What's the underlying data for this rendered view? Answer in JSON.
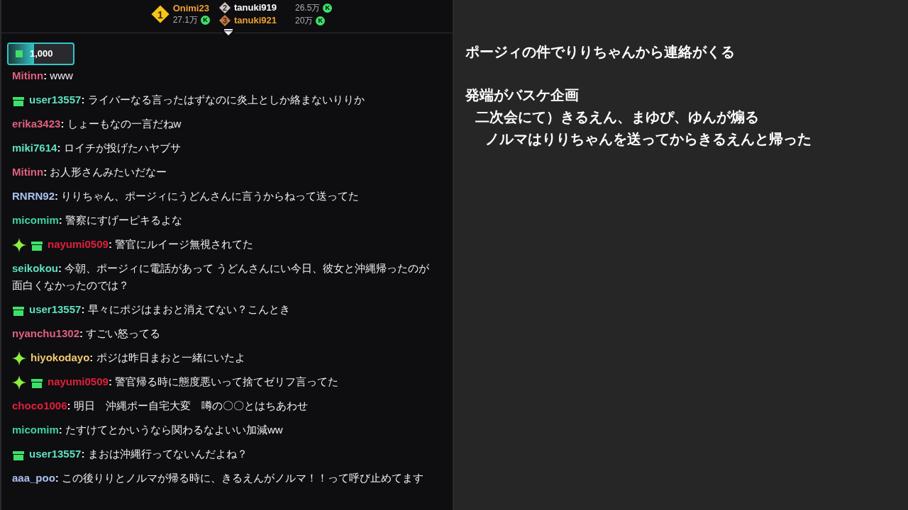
{
  "leaderboard": [
    {
      "rank": "1",
      "name": "Onimi23",
      "points": "27.1万",
      "coin": "K"
    },
    {
      "rank": "2",
      "name": "tanuki919",
      "points": "26.5万",
      "coin": "K"
    },
    {
      "rank": "3",
      "name": "tanuki921",
      "points": "20万",
      "coin": "K"
    }
  ],
  "hype": {
    "amount": "1,000",
    "level": 0.4
  },
  "messages": [
    {
      "user": "Mitinn",
      "color": "#e0607e",
      "separator": ":",
      "text": "www"
    },
    {
      "badges": [
        {
          "kind": "gift"
        }
      ],
      "user": "user13557",
      "color": "#5fe0c0",
      "separator": ":",
      "text": "ライバーなる言ったはずなのに炎上としか絡まないりりか"
    },
    {
      "user": "erika3423",
      "color": "#e0607e",
      "separator": ":",
      "text": "しょーもなの一言だねw"
    },
    {
      "user": "miki7614",
      "color": "#5fe0c0",
      "separator": ":",
      "text": "ロイチが投げたハヤブサ"
    },
    {
      "user": "Mitinn",
      "color": "#e0607e",
      "separator": ":",
      "text": "お人形さんみたいだなー"
    },
    {
      "user": "RNRN92",
      "color": "#a8c0f0",
      "separator": ":",
      "text": "りりちゃん、ポージィにうどんさんに言うからねって送ってた"
    },
    {
      "user": "micomim",
      "color": "#3fd0a0",
      "separator": ":",
      "text": "警察にすげーピキるよな"
    },
    {
      "badges": [
        {
          "kind": "sparkle"
        },
        {
          "kind": "gift"
        }
      ],
      "user": "nayumi0509",
      "color": "#e0203c",
      "separator": ":",
      "text": "警官にルイージ無視されてた"
    },
    {
      "user": "seikokou",
      "color": "#5fe0c0",
      "separator": ":",
      "text": "今朝、ポージィに電話があって うどんさんにい今日、彼女と沖縄帰ったのが面白くなかったのでは？"
    },
    {
      "badges": [
        {
          "kind": "gift"
        }
      ],
      "user": "user13557",
      "color": "#5fe0c0",
      "separator": ":",
      "text": "早々にポジはまおと消えてない？こんとき"
    },
    {
      "user": "nyanchu1302",
      "color": "#e0607e",
      "separator": ":",
      "text": "すごい怒ってる"
    },
    {
      "badges": [
        {
          "kind": "sparkle"
        }
      ],
      "user": "hiyokodayo",
      "color": "#f0c870",
      "separator": ":",
      "text": "ポジは昨日まおと一緒にいたよ"
    },
    {
      "badges": [
        {
          "kind": "sparkle"
        },
        {
          "kind": "gift"
        }
      ],
      "user": "nayumi0509",
      "color": "#e0203c",
      "separator": ":",
      "text": "警官帰る時に態度悪いって捨てゼリフ言ってた"
    },
    {
      "user": "choco1006",
      "color": "#e0203c",
      "separator": ":",
      "text": "明日　沖縄ポー自宅大変　噂の〇〇とはちあわせ"
    },
    {
      "user": "micomim",
      "color": "#3fd0a0",
      "separator": ":",
      "text": "たすけてとかいうなら関わるなよいい加減ww"
    },
    {
      "badges": [
        {
          "kind": "gift"
        }
      ],
      "user": "user13557",
      "color": "#5fe0c0",
      "separator": ":",
      "text": "まおは沖縄行ってないんだよね？"
    },
    {
      "user": "aaa_poo",
      "color": "#a8c0f0",
      "separator": ":",
      "text": "この後りりとノルマが帰る時に、きるえんがノルマ！！って呼び止めてます"
    }
  ],
  "notes": [
    {
      "text": "ポージィの件でりりちゃんから連絡がくる"
    },
    {
      "text": "発端がバスケ企画",
      "children": [
        {
          "text": "二次会にて）きるえん、まゆぴ、ゆんが煽る",
          "children": [
            {
              "text": "ノルマはりりちゃんを送ってからきるえんと帰った"
            }
          ]
        }
      ]
    }
  ]
}
